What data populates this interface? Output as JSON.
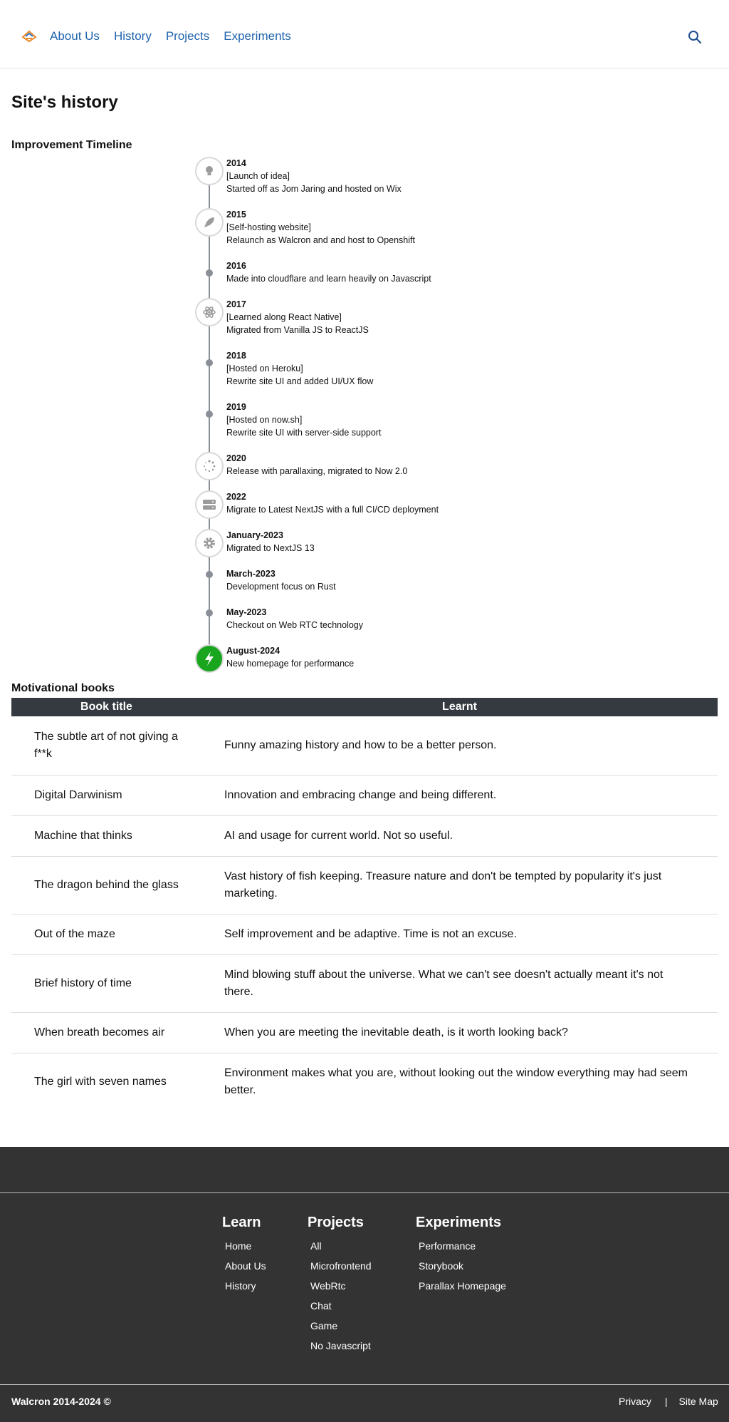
{
  "nav": {
    "logo_icon": "walcron-logo-icon",
    "items": [
      {
        "label": "About Us"
      },
      {
        "label": "History"
      },
      {
        "label": "Projects"
      },
      {
        "label": "Experiments"
      }
    ],
    "search_icon": "search-icon"
  },
  "page_title": "Site's history",
  "timeline": {
    "heading": "Improvement Timeline",
    "entries": [
      {
        "date": "2014",
        "title": "[Launch of idea]",
        "desc": "Started off as Jom Jaring and hosted on Wix",
        "icon": "lightbulb-icon"
      },
      {
        "date": "2015",
        "title": "[Self-hosting website]",
        "desc": "Relaunch as Walcron and and host to Openshift",
        "icon": "rocket-icon"
      },
      {
        "date": "2016",
        "title": "",
        "desc": "Made into cloudflare and learn heavily on Javascript",
        "icon": "dot"
      },
      {
        "date": "2017",
        "title": "[Learned along React Native]",
        "desc": "Migrated from Vanilla JS to ReactJS",
        "icon": "react-icon"
      },
      {
        "date": "2018",
        "title": "[Hosted on Heroku]",
        "desc": "Rewrite site UI and added UI/UX flow",
        "icon": "dot"
      },
      {
        "date": "2019",
        "title": "[Hosted on now.sh]",
        "desc": "Rewrite site UI with server-side support",
        "icon": "dot"
      },
      {
        "date": "2020",
        "title": "",
        "desc": "Release with parallaxing, migrated to Now 2.0",
        "icon": "spinner-icon"
      },
      {
        "date": "2022",
        "title": "",
        "desc": "Migrate to Latest NextJS with a full CI/CD deployment",
        "icon": "server-icon"
      },
      {
        "date": "January-2023",
        "title": "",
        "desc": "Migrated to NextJS 13",
        "icon": "gear-icon"
      },
      {
        "date": "March-2023",
        "title": "",
        "desc": "Development focus on Rust",
        "icon": "dot"
      },
      {
        "date": "May-2023",
        "title": "",
        "desc": "Checkout on Web RTC technology",
        "icon": "dot"
      },
      {
        "date": "August-2024",
        "title": "",
        "desc": "New homepage for performance",
        "icon": "lightning-bolt-icon"
      }
    ],
    "accent_color": "#19a51e"
  },
  "books": {
    "heading": "Motivational books",
    "columns": [
      "Book title",
      "Learnt"
    ],
    "rows": [
      [
        "The subtle art of not giving a f**k",
        "Funny amazing history and how to be a better person."
      ],
      [
        "Digital Darwinism",
        "Innovation and embracing change and being different."
      ],
      [
        "Machine that thinks",
        "AI and usage for current world. Not so useful."
      ],
      [
        "The dragon behind the glass",
        "Vast history of fish keeping. Treasure nature and don't be tempted by popularity it's just marketing."
      ],
      [
        "Out of the maze",
        "Self improvement and be adaptive. Time is not an excuse."
      ],
      [
        "Brief history of time",
        "Mind blowing stuff about the universe. What we can't see doesn't actually meant it's not there."
      ],
      [
        "When breath becomes air",
        "When you are meeting the inevitable death, is it worth looking back?"
      ],
      [
        "The girl with seven names",
        "Environment makes what you are, without looking out the window everything may had seem better."
      ]
    ]
  },
  "footer": {
    "columns": [
      {
        "title": "Learn",
        "links": [
          "Home",
          "About Us",
          "History"
        ]
      },
      {
        "title": "Projects",
        "links": [
          "All",
          "Microfrontend",
          "WebRtc",
          "Chat",
          "Game",
          "No Javascript"
        ]
      },
      {
        "title": "Experiments",
        "links": [
          "Performance",
          "Storybook",
          "Parallax Homepage"
        ]
      }
    ],
    "copyright": "Walcron 2014-2024 ©",
    "legal": {
      "privacy": "Privacy",
      "separator": "|",
      "sitemap": "Site Map"
    },
    "background": "#343334"
  }
}
